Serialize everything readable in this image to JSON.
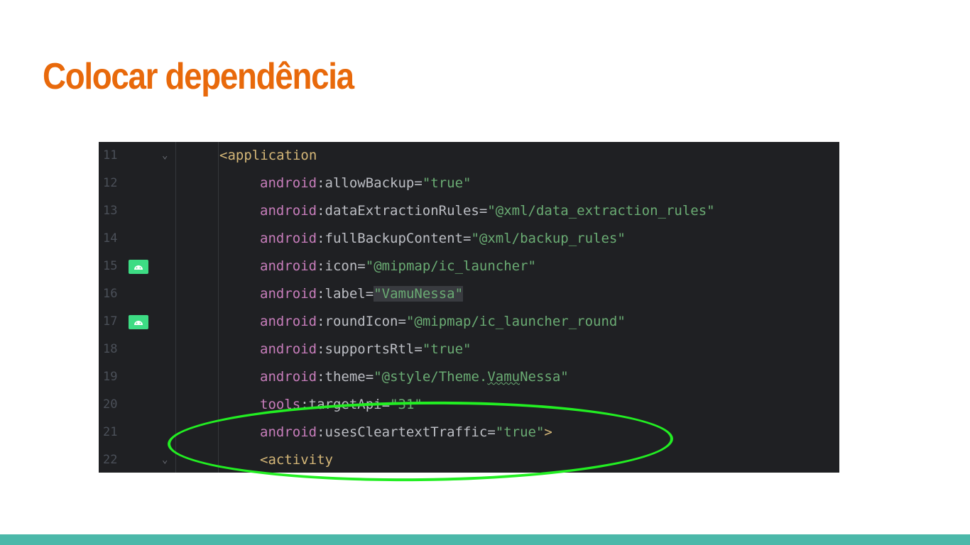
{
  "slide": {
    "title": "Colocar dependência"
  },
  "editor": {
    "lines": [
      {
        "number": "11",
        "tag": "<application"
      },
      {
        "number": "12",
        "ns": "android",
        "sep": ":",
        "name": "allowBackup",
        "eq": "=",
        "value": "\"true\""
      },
      {
        "number": "13",
        "ns": "android",
        "sep": ":",
        "name": "dataExtractionRules",
        "eq": "=",
        "value": "\"@xml/data_extraction_rules\""
      },
      {
        "number": "14",
        "ns": "android",
        "sep": ":",
        "name": "fullBackupContent",
        "eq": "=",
        "value": "\"@xml/backup_rules\""
      },
      {
        "number": "15",
        "ns": "android",
        "sep": ":",
        "name": "icon",
        "eq": "=",
        "value": "\"@mipmap/ic_launcher\""
      },
      {
        "number": "16",
        "ns": "android",
        "sep": ":",
        "name": "label",
        "eq": "=",
        "value": "\"VamuNessa\""
      },
      {
        "number": "17",
        "ns": "android",
        "sep": ":",
        "name": "roundIcon",
        "eq": "=",
        "value": "\"@mipmap/ic_launcher_round\""
      },
      {
        "number": "18",
        "ns": "android",
        "sep": ":",
        "name": "supportsRtl",
        "eq": "=",
        "value": "\"true\""
      },
      {
        "number": "19",
        "ns": "android",
        "sep": ":",
        "name": "theme",
        "eq": "=",
        "value_prefix": "\"@style/Theme.",
        "value_typo": "Vamu",
        "value_suffix": "Nessa\""
      },
      {
        "number": "20",
        "ns": "tools",
        "sep": ":",
        "name": "targetApi",
        "eq": "=",
        "value": "\"31\""
      },
      {
        "number": "21",
        "ns": "android",
        "sep": ":",
        "name": "usesCleartextTraffic",
        "eq": "=",
        "value": "\"true\"",
        "close": ">"
      },
      {
        "number": "22",
        "tag": "<activity"
      }
    ]
  },
  "colors": {
    "title": "#e8690b",
    "editor_background": "#1f2023",
    "highlight_ellipse": "#22ee22",
    "footer_bar": "#4bb8a9",
    "android_gutter_icon": "#3ddc84"
  },
  "icons": {
    "fold": "chevron-down-icon",
    "gutter": "android-icon"
  }
}
